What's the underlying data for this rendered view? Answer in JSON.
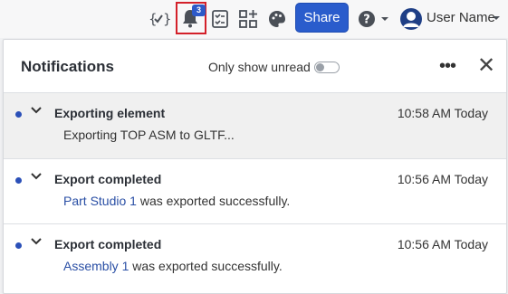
{
  "toolbar": {
    "icons": [
      "variable-check-icon",
      "bell-icon",
      "checklist-icon",
      "apps-icon",
      "palette-icon",
      "help-icon"
    ],
    "notification_count": "3",
    "share_label": "Share",
    "user_name": "User Name",
    "highlight_color": "#d3202a",
    "accent": "#2a5ccc"
  },
  "panel": {
    "title": "Notifications",
    "unread_label": "Only show unread",
    "unread_toggle_on": false
  },
  "notifications": [
    {
      "title": "Exporting element",
      "time": "10:58 AM Today",
      "body_link": "",
      "body_text": "Exporting TOP ASM to GLTF..."
    },
    {
      "title": "Export completed",
      "time": "10:56 AM Today",
      "body_link": "Part Studio 1",
      "body_text": " was exported successfully."
    },
    {
      "title": "Export completed",
      "time": "10:56 AM Today",
      "body_link": "Assembly 1",
      "body_text": " was exported successfully."
    }
  ]
}
